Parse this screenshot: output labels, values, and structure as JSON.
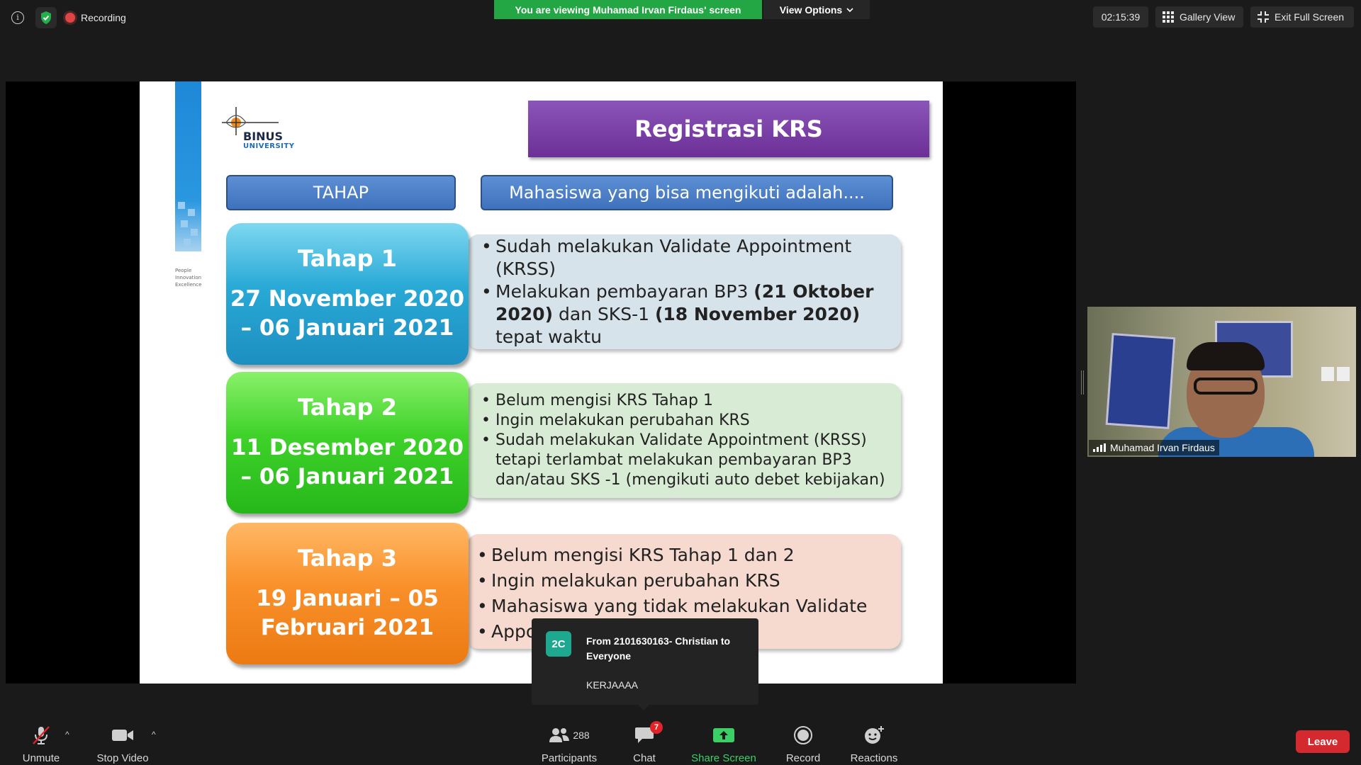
{
  "topbar": {
    "recording_label": "Recording",
    "viewing_banner": "You are viewing Muhamad Irvan Firdaus' screen",
    "view_options_label": "View Options",
    "timer": "02:15:39",
    "gallery_view_label": "Gallery View",
    "exit_full_screen_label": "Exit Full Screen",
    "icons": [
      "info-icon",
      "shield-check-icon",
      "record-dot-icon",
      "grid-icon",
      "exit-fullscreen-icon"
    ]
  },
  "slide": {
    "logo_name": "BINUS",
    "logo_sub": "UNIVERSITY",
    "tagline": [
      "People",
      "Innovation",
      "Excellence"
    ],
    "title": "Registrasi KRS",
    "header_tahap": "TAHAP",
    "header_mahasiswa": "Mahasiswa yang bisa mengikuti adalah....",
    "stages": [
      {
        "name": "Tahap 1",
        "date_line1": "27 November 2020",
        "date_line2": "– 06 Januari 2021",
        "bullets": [
          {
            "text": "Sudah melakukan Validate Appointment (KRSS)"
          },
          {
            "pre": "Melakukan pembayaran BP3 ",
            "bold1": "(21 Oktober 2020)",
            "mid": " dan SKS-1 ",
            "bold2": "(18 November 2020)",
            "post": " tepat waktu"
          }
        ]
      },
      {
        "name": "Tahap 2",
        "date_line1": "11 Desember 2020",
        "date_line2": "– 06 Januari 2021",
        "bullets": [
          {
            "text": "Belum mengisi KRS Tahap 1"
          },
          {
            "text": "Ingin melakukan perubahan KRS"
          },
          {
            "text": " Sudah melakukan Validate Appointment (KRSS) tetapi terlambat melakukan pembayaran BP3 dan/atau SKS -1 (mengikuti auto debet kebijakan)"
          }
        ]
      },
      {
        "name": "Tahap 3",
        "date_line1": "19 Januari – 05",
        "date_line2": "Februari 2021",
        "bullets": [
          {
            "text": "Belum mengisi KRS Tahap 1 dan 2"
          },
          {
            "text": "Ingin melakukan perubahan KRS"
          },
          {
            "text": "Mahasiswa yang tidak melakukan Validate"
          },
          {
            "text": "Appo"
          }
        ]
      }
    ],
    "colors": {
      "title_purple": "#7a3fa8",
      "header_blue": "#4a7cc4",
      "stage1": "#29a9d6",
      "stage2": "#3fd22a",
      "stage3": "#f9902a"
    }
  },
  "participant_video": {
    "name": "Muhamad Irvan Firdaus"
  },
  "chat_popup": {
    "avatar_initials": "2C",
    "from_text": "From 2101630163- Christian to Everyone",
    "message": "KERJAAAA"
  },
  "toolbar": {
    "unmute_label": "Unmute",
    "stop_video_label": "Stop Video",
    "participants_label": "Participants",
    "participants_count": "288",
    "chat_label": "Chat",
    "chat_badge": "7",
    "share_screen_label": "Share Screen",
    "record_label": "Record",
    "reactions_label": "Reactions",
    "leave_label": "Leave",
    "colors": {
      "share_green": "#3ccf66",
      "leave_red": "#d3292f"
    }
  }
}
